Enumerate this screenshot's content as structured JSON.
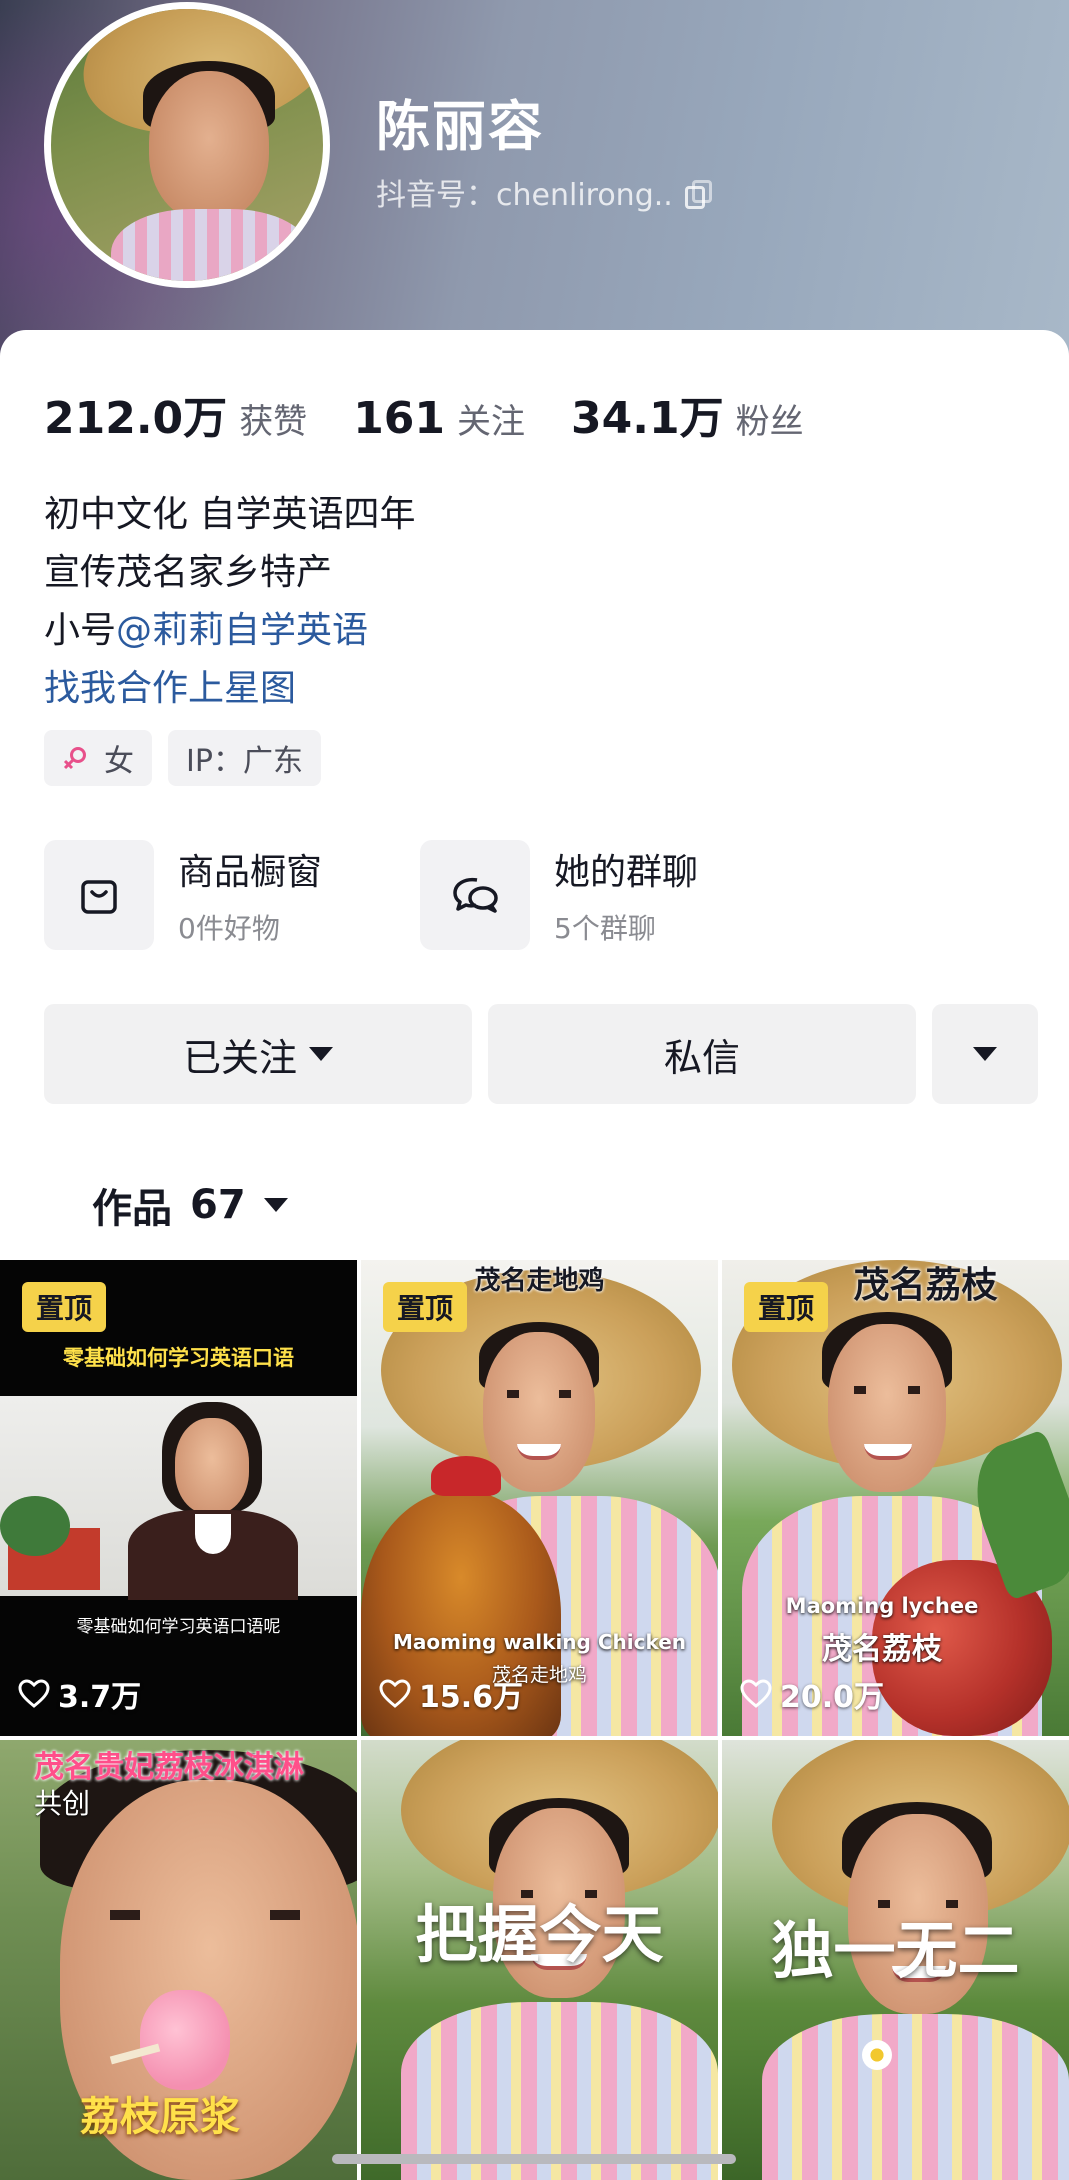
{
  "profile": {
    "name": "陈丽容",
    "douyin_id": "抖音号：chenlirong.."
  },
  "stats": [
    {
      "value": "212.0万",
      "label": "获赞"
    },
    {
      "value": "161",
      "label": "关注"
    },
    {
      "value": "34.1万",
      "label": "粉丝"
    }
  ],
  "bio": {
    "line1": "初中文化 自学英语四年",
    "line2": "宣传茂名家乡特产",
    "line3_prefix": "小号",
    "line3_link": "@莉莉自学英语",
    "line4_link": "找我合作上星图"
  },
  "tags": {
    "gender": "女",
    "ip": "IP：广东"
  },
  "shortcuts": [
    {
      "title": "商品橱窗",
      "subtitle": "0件好物",
      "icon": "shopping-bag-icon"
    },
    {
      "title": "她的群聊",
      "subtitle": "5个群聊",
      "icon": "chat-bubbles-icon"
    }
  ],
  "actions": {
    "follow": "已关注",
    "message": "私信"
  },
  "works_tab": {
    "label": "作品",
    "count": "67"
  },
  "videos": [
    {
      "pinned": "置顶",
      "title": "零基础如何学习英语口语",
      "subtitle": "零基础如何学习英语口语呢",
      "likes": "3.7万"
    },
    {
      "pinned": "置顶",
      "title": "茂名走地鸡",
      "caption_en": "Maoming walking Chicken",
      "caption_cn": "茂名走地鸡",
      "likes": "15.6万"
    },
    {
      "pinned": "置顶",
      "title": "茂名荔枝",
      "caption_en": "Maoming lychee",
      "caption_cn": "茂名荔枝",
      "likes": "20.0万"
    },
    {
      "title": "茂名贵妃荔枝冰淇淋",
      "badge": "共创",
      "caption": "荔枝原浆"
    },
    {
      "caption": "把握今天"
    },
    {
      "caption": "独一无二"
    }
  ],
  "colors": {
    "accent_link": "#2b5a9e",
    "pin_badge": "#f5d24a",
    "female": "#e8508a"
  }
}
